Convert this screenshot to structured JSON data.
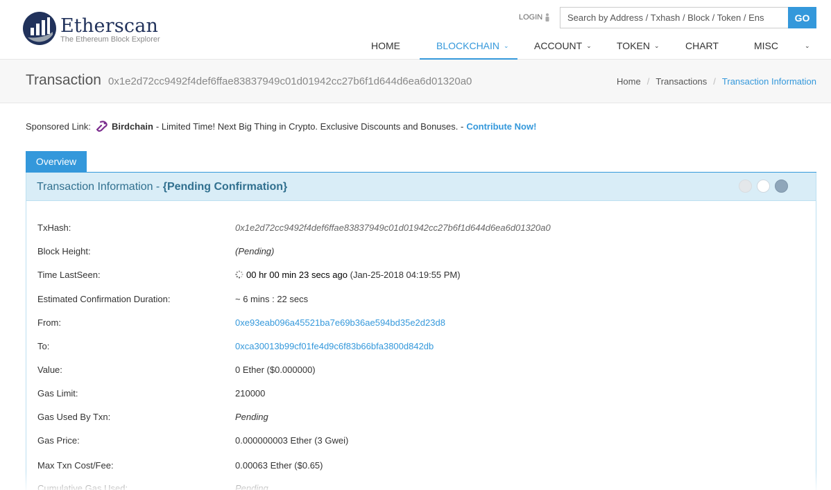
{
  "header": {
    "logo_name": "Etherscan",
    "logo_tagline": "The Ethereum Block Explorer",
    "login_label": "LOGIN",
    "search_placeholder": "Search by Address / Txhash / Block / Token / Ens",
    "search_button": "GO",
    "nav": [
      {
        "label": "HOME",
        "dropdown": false,
        "active": false
      },
      {
        "label": "BLOCKCHAIN",
        "dropdown": true,
        "active": true
      },
      {
        "label": "ACCOUNT",
        "dropdown": true,
        "active": false
      },
      {
        "label": "TOKEN",
        "dropdown": true,
        "active": false
      },
      {
        "label": "CHART",
        "dropdown": false,
        "active": false
      },
      {
        "label": "MISC",
        "dropdown": true,
        "active": false
      }
    ]
  },
  "title_band": {
    "title": "Transaction",
    "hash": "0x1e2d72cc9492f4def6ffae83837949c01d01942cc27b6f1d644d6ea6d01320a0",
    "breadcrumb": [
      "Home",
      "Transactions",
      "Transaction Information"
    ]
  },
  "sponsored": {
    "prefix": "Sponsored Link:",
    "brand": "Birdchain",
    "message": "- Limited Time! Next Big Thing in Crypto. Exclusive Discounts and Bonuses. -",
    "link": "Contribute Now!"
  },
  "tabs": {
    "overview": "Overview"
  },
  "panel": {
    "title_prefix": "Transaction Information -",
    "title_status": "{Pending Confirmation}"
  },
  "details": {
    "txhash": {
      "label": "TxHash:",
      "value": "0x1e2d72cc9492f4def6ffae83837949c01d01942cc27b6f1d644d6ea6d01320a0"
    },
    "block_height": {
      "label": "Block Height:",
      "value": "(Pending)"
    },
    "time_lastseen": {
      "label": "Time LastSeen:",
      "value": "00 hr 00 min 23 secs ago",
      "date": "(Jan-25-2018 04:19:55 PM)"
    },
    "est_duration": {
      "label": "Estimated Confirmation Duration:",
      "value": "~ 6 mins : 22 secs"
    },
    "from": {
      "label": "From:",
      "value": "0xe93eab096a45521ba7e69b36ae594bd35e2d23d8"
    },
    "to": {
      "label": "To:",
      "value": "0xca30013b99cf01fe4d9c6f83b66bfa3800d842db"
    },
    "value": {
      "label": "Value:",
      "value": "0 Ether ($0.000000)"
    },
    "gas_limit": {
      "label": "Gas Limit:",
      "value": "210000"
    },
    "gas_used": {
      "label": "Gas Used By Txn:",
      "value": "Pending"
    },
    "gas_price": {
      "label": "Gas Price:",
      "value": "0.000000003 Ether (3 Gwei)"
    },
    "max_fee": {
      "label": "Max Txn Cost/Fee:",
      "value": "0.00063 Ether ($0.65)"
    },
    "cumulative_gas": {
      "label": "Cumulative Gas Used:",
      "value": "Pending"
    }
  },
  "colors": {
    "accent": "#3498db",
    "panel_header_bg": "#d9edf7",
    "panel_header_text": "#31708f",
    "logo_navy": "#21325b"
  }
}
